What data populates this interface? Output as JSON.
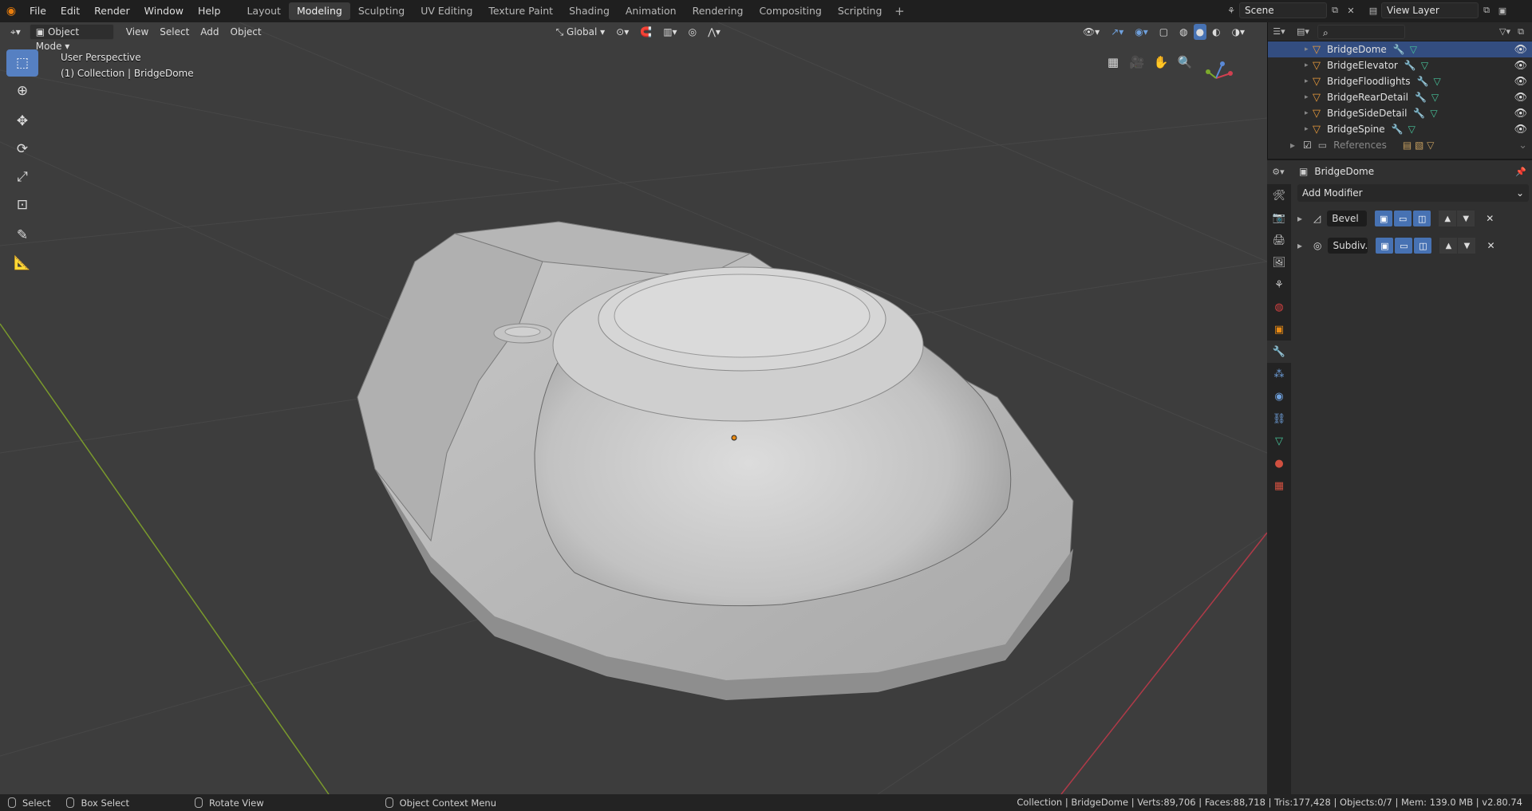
{
  "menu": [
    "File",
    "Edit",
    "Render",
    "Window",
    "Help"
  ],
  "workspaces": [
    "Layout",
    "Modeling",
    "Sculpting",
    "UV Editing",
    "Texture Paint",
    "Shading",
    "Animation",
    "Rendering",
    "Compositing",
    "Scripting"
  ],
  "active_workspace": "Modeling",
  "scene": "Scene",
  "view_layer": "View Layer",
  "viewport_header": {
    "mode": "Object Mode",
    "menus": [
      "View",
      "Select",
      "Add",
      "Object"
    ],
    "transform_orientation": "Global"
  },
  "viewport_info": {
    "perspective": "User Perspective",
    "collection": "(1) Collection | BridgeDome"
  },
  "outliner": {
    "rows": [
      {
        "name": "BridgeDome",
        "selected": true
      },
      {
        "name": "BridgeElevator",
        "selected": false
      },
      {
        "name": "BridgeFloodlights",
        "selected": false
      },
      {
        "name": "BridgeRearDetail",
        "selected": false
      },
      {
        "name": "BridgeSideDetail",
        "selected": false
      },
      {
        "name": "BridgeSpine",
        "selected": false
      }
    ],
    "collection_row": "References"
  },
  "properties": {
    "object_name": "BridgeDome",
    "add_modifier": "Add Modifier",
    "modifiers": [
      {
        "name": "Bevel"
      },
      {
        "name": "Subdiv.."
      }
    ]
  },
  "status_bar": {
    "select": "Select",
    "box_select": "Box Select",
    "rotate_view": "Rotate View",
    "context_menu": "Object Context Menu",
    "stats": "Collection | BridgeDome | Verts:89,706 | Faces:88,718 | Tris:177,428 | Objects:0/7 | Mem: 139.0 MB | v2.80.74"
  },
  "colors": {
    "accent": "#4772b3",
    "selected_row": "#334d80",
    "object_icon": "#e89a3c",
    "viewport_bg": "#3d3d3d"
  }
}
